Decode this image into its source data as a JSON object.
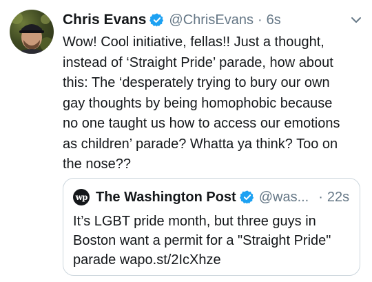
{
  "tweet": {
    "author_name": "Chris Evans",
    "author_handle": "@ChrisEvans",
    "separator": "·",
    "time": "6s",
    "text": "Wow! Cool initiative, fellas!! Just a thought,\ninstead of ‘Straight Pride’ parade, how about\nthis: The ‘desperately trying to bury our own\ngay thoughts by being homophobic because\nno one taught us how to access our emotions\nas children’ parade? Whatta ya think? Too on\nthe nose??",
    "verified_color": "#1da1f2"
  },
  "quoted_tweet": {
    "logo_text": "wp",
    "author_name": "The Washington Post",
    "author_handle": "@was...",
    "separator": "·",
    "time": "22s",
    "text": "It’s LGBT pride month, but three guys in\nBoston want a permit for a \"Straight Pride\"\nparade wapo.st/2IcXhze"
  },
  "icons": {
    "verified": "verified-badge-icon",
    "menu": "chevron-down-icon",
    "quoted_logo": "washington-post-logo-icon"
  }
}
